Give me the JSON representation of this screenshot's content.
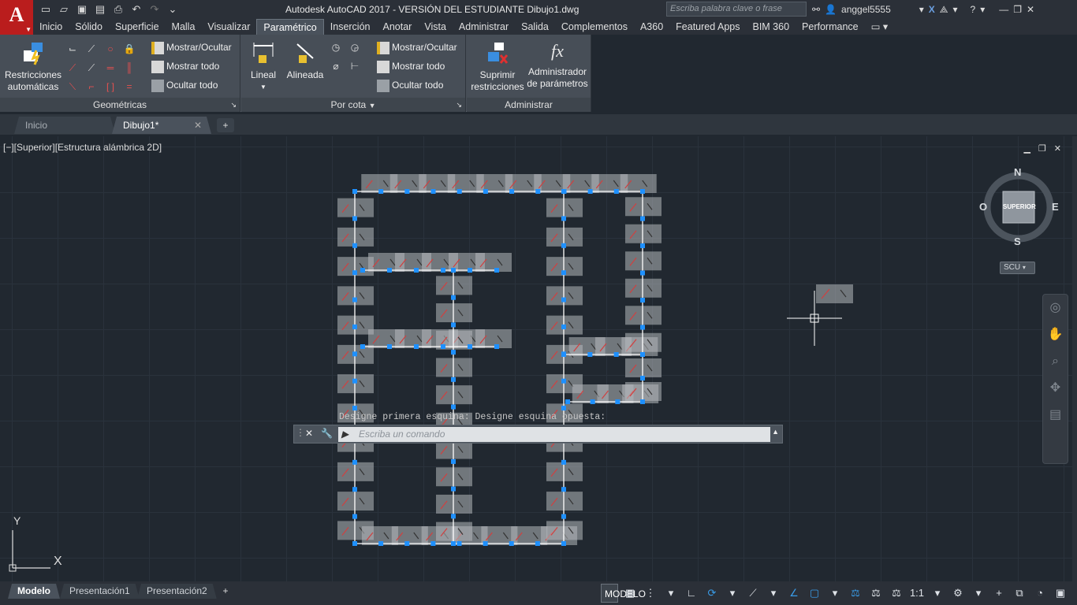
{
  "app": {
    "logo": "A",
    "title": "Autodesk AutoCAD 2017 - VERSIÓN DEL ESTUDIANTE    Dibujo1.dwg",
    "search_placeholder": "Escriba palabra clave o frase",
    "user": "anggel5555"
  },
  "quick_access": [
    "new-icon",
    "open-icon",
    "save-icon",
    "saveas-icon",
    "print-icon",
    "undo-icon",
    "redo-icon",
    "workspace-dropdown-icon"
  ],
  "ribbon_tabs": [
    {
      "label": "Inicio",
      "active": false
    },
    {
      "label": "Sólido",
      "active": false
    },
    {
      "label": "Superficie",
      "active": false
    },
    {
      "label": "Malla",
      "active": false
    },
    {
      "label": "Visualizar",
      "active": false
    },
    {
      "label": "Paramétrico",
      "active": true
    },
    {
      "label": "Inserción",
      "active": false
    },
    {
      "label": "Anotar",
      "active": false
    },
    {
      "label": "Vista",
      "active": false
    },
    {
      "label": "Administrar",
      "active": false
    },
    {
      "label": "Salida",
      "active": false
    },
    {
      "label": "Complementos",
      "active": false
    },
    {
      "label": "A360",
      "active": false
    },
    {
      "label": "Featured Apps",
      "active": false
    },
    {
      "label": "BIM 360",
      "active": false
    },
    {
      "label": "Performance",
      "active": false
    }
  ],
  "ribbon": {
    "geometricas": {
      "title": "Geométricas",
      "auto_line1": "Restricciones",
      "auto_line2": "automáticas",
      "mostrar_ocultar": "Mostrar/Ocultar",
      "mostrar_todo": "Mostrar todo",
      "ocultar_todo": "Ocultar todo"
    },
    "porcota": {
      "title": "Por cota",
      "lineal": "Lineal",
      "alineada": "Alineada",
      "mostrar_ocultar": "Mostrar/Ocultar",
      "mostrar_todo": "Mostrar todo",
      "ocultar_todo": "Ocultar todo"
    },
    "administrar": {
      "title": "Administrar",
      "suprimir_line1": "Suprimir",
      "suprimir_line2": "restricciones",
      "admin_line1": "Administrador",
      "admin_line2": "de parámetros",
      "fx": "fx"
    }
  },
  "doc_tabs": [
    {
      "label": "Inicio",
      "active": false
    },
    {
      "label": "Dibujo1*",
      "active": true
    }
  ],
  "viewport": {
    "label": "[−][Superior][Estructura alámbrica 2D]",
    "viewcube": {
      "top": "SUPERIOR",
      "n": "N",
      "s": "S",
      "e": "E",
      "w": "O"
    },
    "scu": "SCU",
    "ucs_y": "Y",
    "ucs_x": "X"
  },
  "command": {
    "history": "Designe primera esquina: Designe esquina opuesta:",
    "placeholder": "Escriba un comando"
  },
  "layout_tabs": [
    {
      "label": "Modelo",
      "active": true
    },
    {
      "label": "Presentación1",
      "active": false
    },
    {
      "label": "Presentación2",
      "active": false
    }
  ],
  "status": {
    "model": "MODELO",
    "scale": "1:1"
  },
  "colors": {
    "canvas": "#212830",
    "grip": "#1e90ff",
    "constraint_bar": "#b8b8b8",
    "geometry": "#ffffff",
    "accent_red": "#ba1d1d"
  }
}
